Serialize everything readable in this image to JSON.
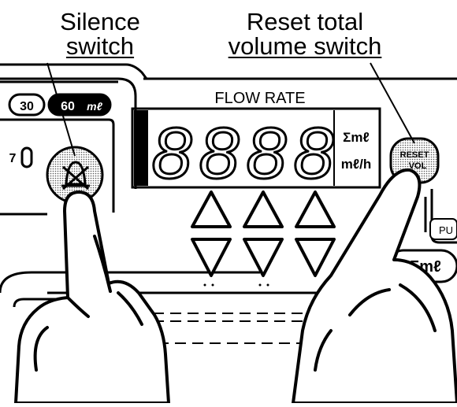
{
  "callouts": {
    "silence": {
      "line1": "Silence",
      "line2": "switch"
    },
    "reset": {
      "line1": "Reset total",
      "line2": "volume switch"
    }
  },
  "panel": {
    "display_title": "FLOW RATE",
    "digits": [
      "8",
      "8",
      "8",
      "8"
    ],
    "units": {
      "total": "Σmℓ",
      "rate": "mℓ/h"
    },
    "volume_presets": [
      "30",
      "60"
    ],
    "preset_unit": "mℓ",
    "left_tag": "7",
    "reset_button": {
      "line1": "RESET",
      "line2": "VOL"
    },
    "right_tag": "PU",
    "sum_button": "Σmℓ"
  },
  "icons": {
    "silence": "crossed-bell-icon",
    "up": "triangle-up-icon",
    "down": "triangle-down-icon"
  },
  "colors": {
    "ink": "#000000",
    "paper": "#ffffff",
    "stipple": "#b8b8b8"
  }
}
